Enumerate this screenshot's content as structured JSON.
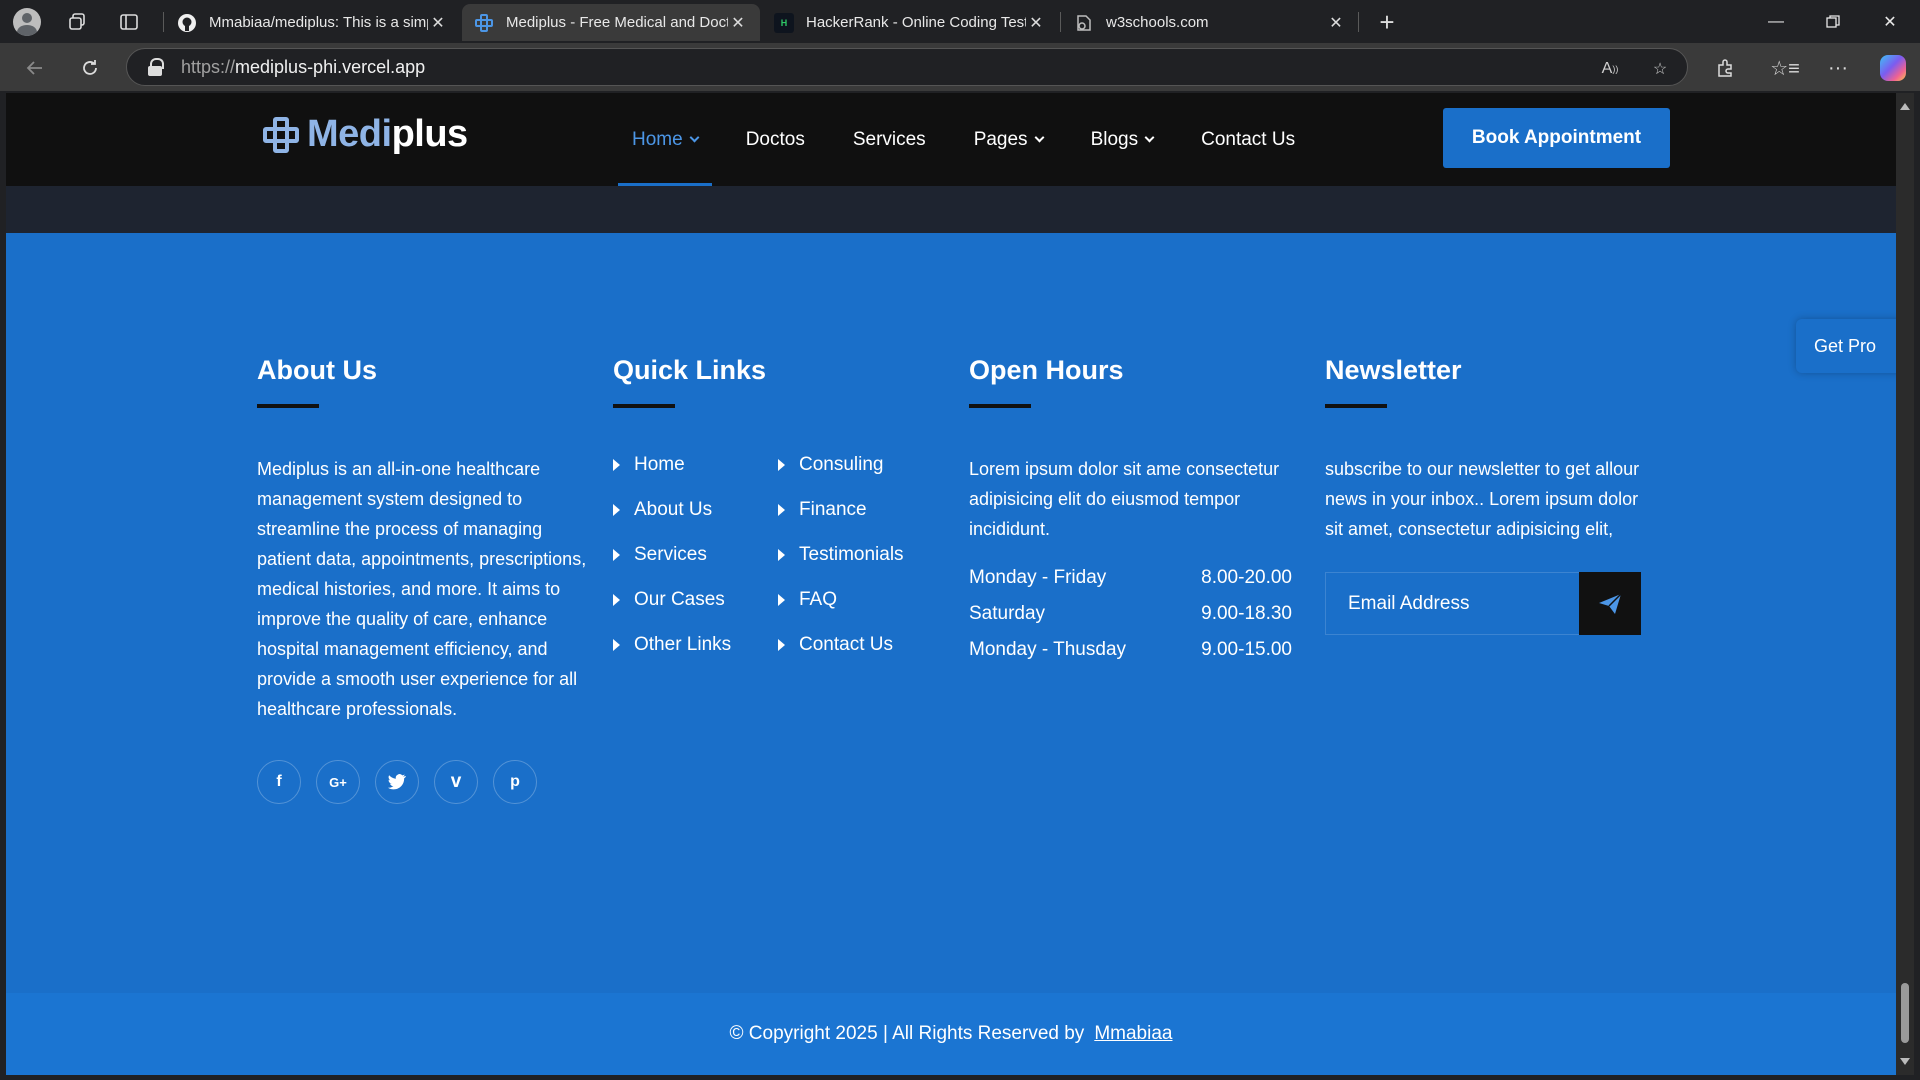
{
  "browser": {
    "tabs": [
      {
        "title": "Mmabiaa/mediplus: This is a simp",
        "favicon": "github-icon"
      },
      {
        "title": "Mediplus - Free Medical and Doct",
        "favicon": "mediplus-icon"
      },
      {
        "title": "HackerRank - Online Coding Tests",
        "favicon": "hackerrank-icon"
      },
      {
        "title": "w3schools.com",
        "favicon": "w3schools-icon"
      }
    ],
    "url_proto": "https://",
    "url_host": "mediplus-phi.vercel.app"
  },
  "site": {
    "logo_a": "Medi",
    "logo_b": "plus",
    "nav": {
      "home": "Home",
      "doctors": "Doctos",
      "services": "Services",
      "pages": "Pages",
      "blogs": "Blogs",
      "contact": "Contact Us"
    },
    "book_button": "Book Appointment",
    "get_pro": "Get Pro"
  },
  "footer": {
    "about": {
      "heading": "About Us",
      "text": "Mediplus is an all-in-one healthcare management system designed to streamline the process of managing patient data, appointments, prescriptions, medical histories, and more. It aims to improve the quality of care, enhance hospital management efficiency, and provide a smooth user experience for all healthcare professionals.",
      "socials": [
        "f",
        "G+",
        "t",
        "v",
        "p"
      ]
    },
    "quick_links": {
      "heading": "Quick Links",
      "col1": [
        "Home",
        "About Us",
        "Services",
        "Our Cases",
        "Other Links"
      ],
      "col2": [
        "Consuling",
        "Finance",
        "Testimonials",
        "FAQ",
        "Contact Us"
      ]
    },
    "open_hours": {
      "heading": "Open Hours",
      "text": "Lorem ipsum dolor sit ame consectetur adipisicing elit do eiusmod tempor incididunt.",
      "rows": [
        {
          "day": "Monday - Friday",
          "time": "8.00-20.00"
        },
        {
          "day": "Saturday",
          "time": "9.00-18.30"
        },
        {
          "day": "Monday - Thusday",
          "time": "9.00-15.00"
        }
      ]
    },
    "newsletter": {
      "heading": "Newsletter",
      "text": "subscribe to our newsletter to get allour news in your inbox.. Lorem ipsum dolor sit amet, consectetur adipisicing elit,",
      "placeholder": "Email Address"
    },
    "copyright": "© Copyright 2025 | All Rights Reserved by",
    "author": "Mmabiaa"
  },
  "colors": {
    "primary": "#1a6fc9",
    "header_bg": "#101010",
    "accent_link": "#4c96e6"
  }
}
